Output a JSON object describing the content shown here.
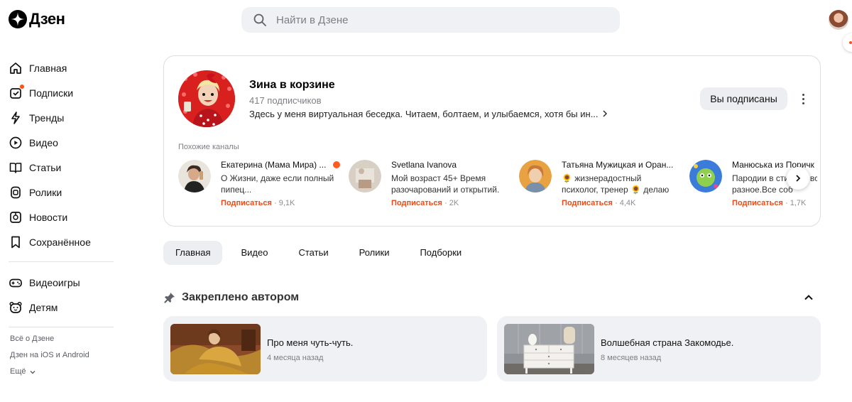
{
  "brand": {
    "name": "Дзен"
  },
  "search": {
    "placeholder": "Найти в Дзене"
  },
  "sidebar": {
    "main_items": [
      {
        "label": "Главная",
        "icon": "home-icon"
      },
      {
        "label": "Подписки",
        "icon": "subscriptions-icon"
      },
      {
        "label": "Тренды",
        "icon": "trends-icon"
      },
      {
        "label": "Видео",
        "icon": "video-icon"
      },
      {
        "label": "Статьи",
        "icon": "articles-icon"
      },
      {
        "label": "Ролики",
        "icon": "shorts-icon"
      },
      {
        "label": "Новости",
        "icon": "news-icon"
      },
      {
        "label": "Сохранённое",
        "icon": "bookmark-icon"
      }
    ],
    "extra_items": [
      {
        "label": "Видеоигры",
        "icon": "gamepad-icon"
      },
      {
        "label": "Детям",
        "icon": "kids-icon"
      }
    ],
    "footer": {
      "about": "Всё о Дзене",
      "apps": "Дзен на iOS и Android",
      "more": "Ещё"
    }
  },
  "channel": {
    "name": "Зина в корзине",
    "subscribers": "417 подписчиков",
    "description": "Здесь у меня виртуальная беседка. Читаем, болтаем, и улыбаемся, хотя бы ин...",
    "subscribed_label": "Вы подписаны",
    "similar_title": "Похожие каналы",
    "similar": [
      {
        "name": "Екатерина (Мама Мира) ...",
        "desc": "О Жизни, даже если полный пипец...",
        "subscribe": "Подписаться",
        "count": "· 9,1K",
        "verified": true
      },
      {
        "name": "Svetlana Ivanova",
        "desc": "Мой возраст 45+ Время разочарований и открытий. ...",
        "subscribe": "Подписаться",
        "count": "· 2K",
        "verified": false
      },
      {
        "name": "Татьяна Мужицкая и Оран...",
        "desc": "🌻 жизнерадостный психолог, тренер 🌻 делаю людей...",
        "subscribe": "Подписаться",
        "count": "· 4,4K",
        "verified": false
      },
      {
        "name": "Манюська из Поричк",
        "desc": "Пародии в сти... пр всякое разное.Все соб",
        "subscribe": "Подписаться",
        "count": "· 1,7K",
        "verified": false
      }
    ]
  },
  "tabs": [
    {
      "label": "Главная",
      "active": true
    },
    {
      "label": "Видео",
      "active": false
    },
    {
      "label": "Статьи",
      "active": false
    },
    {
      "label": "Ролики",
      "active": false
    },
    {
      "label": "Подборки",
      "active": false
    }
  ],
  "pinned": {
    "title": "Закреплено автором",
    "items": [
      {
        "title": "Про меня чуть-чуть.",
        "age": "4 месяца назад"
      },
      {
        "title": "Волшебная страна Закомодье.",
        "age": "8 месяцев назад"
      }
    ]
  },
  "colors": {
    "accent": "#ef4a18",
    "surface": "#f0f1f4",
    "text_muted": "#7c7f86"
  }
}
